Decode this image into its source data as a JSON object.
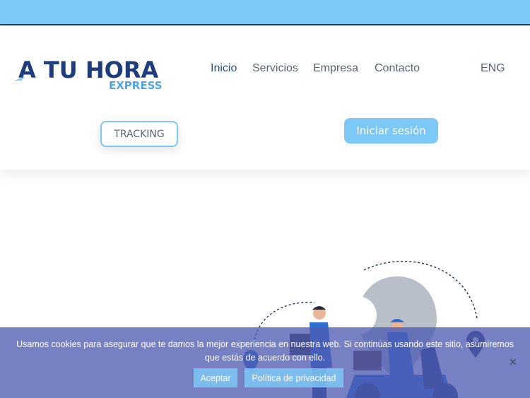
{
  "brand": {
    "logo_main": "A TU HORA",
    "logo_sub": "EXPRESS",
    "colors": {
      "primary": "#2b4d8c",
      "accent": "#7cc8f7",
      "cookie_bg": "#505cb2"
    }
  },
  "nav": {
    "items": [
      "Inicio",
      "Servicios",
      "Empresa",
      "Contacto"
    ],
    "active": "Inicio",
    "lang": "ENG"
  },
  "actions": {
    "tracking": "TRACKING",
    "login": "Iniciar sesión"
  },
  "cookie_banner": {
    "text": "Usamos cookies para asegurar que te damos la mejor experiencia en nuestra web. Si continúas usando este sitio, asumiremos que estás de acuerdo con ello.",
    "accept": "Aceptar",
    "privacy": "Política de privacidad",
    "close_icon": "close-icon"
  },
  "icons": [
    "location-pin-icon",
    "delivery-person-icon",
    "scooter-icon"
  ]
}
